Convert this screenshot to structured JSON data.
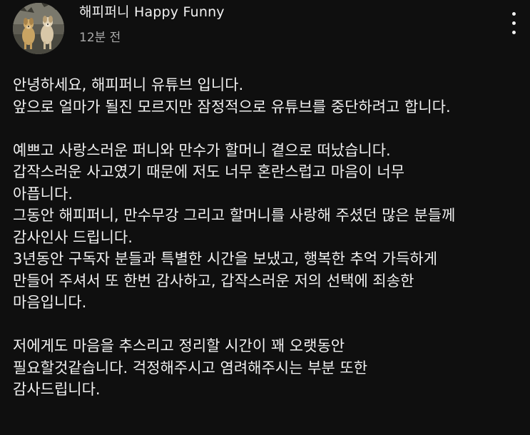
{
  "post": {
    "channel_name": "해피퍼니 Happy Funny",
    "time": "12분 전",
    "menu_icon": "more-vertical-icon",
    "avatar": "channel-avatar-dogs",
    "lines": [
      "안녕하세요, 해피퍼니 유튜브 입니다.",
      "앞으로 얼마가 될진 모르지만 잠정적으로 유튜브를 중단하려고 합니다.",
      "",
      "예쁘고 사랑스러운 퍼니와 만수가 할머니 곁으로 떠났습니다.",
      "갑작스러운 사고였기 때문에 저도 너무 혼란스럽고 마음이 너무",
      "아픕니다.",
      "그동안 해피퍼니, 만수무강 그리고 할머니를 사랑해 주셨던 많은 분들께",
      "감사인사 드립니다.",
      "3년동안 구독자 분들과 특별한 시간을 보냈고, 행복한 추억 가득하게",
      "만들어 주셔서 또 한번 감사하고, 갑작스러운 저의 선택에 죄송한",
      "마음입니다.",
      "",
      "저에게도 마음을 추스리고 정리할 시간이 꽤 오랫동안",
      "필요할것같습니다. 걱정해주시고 염려해주시는 부분 또한",
      "감사드립니다."
    ]
  }
}
